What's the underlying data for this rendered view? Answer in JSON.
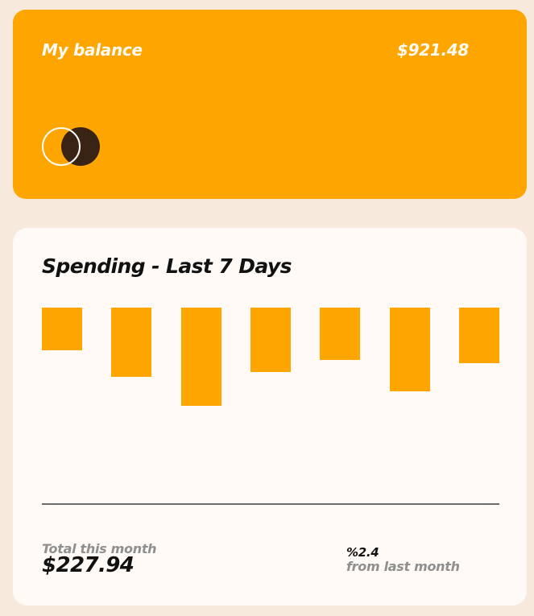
{
  "balance": {
    "label": "My balance",
    "amount": "$921.48"
  },
  "spending": {
    "title": "Spending - Last 7 Days",
    "total_label": "Total this month",
    "total_amount": "$227.94",
    "change_percent": "%2.4",
    "change_label": "from last month"
  },
  "colors": {
    "accent": "#ffa500",
    "background": "#f8e9dd",
    "card": "#fffaf5",
    "dark": "#382314",
    "muted": "#8f8f8f"
  },
  "chart_data": {
    "type": "bar",
    "categories": [
      "",
      "",
      "",
      "",
      "",
      "",
      ""
    ],
    "values": [
      53,
      86,
      122,
      80,
      65,
      104,
      69
    ],
    "title": "Spending - Last 7 Days",
    "xlabel": "",
    "ylabel": "",
    "ylim": [
      0,
      180
    ],
    "orientation": "hanging from top",
    "grid": false
  }
}
